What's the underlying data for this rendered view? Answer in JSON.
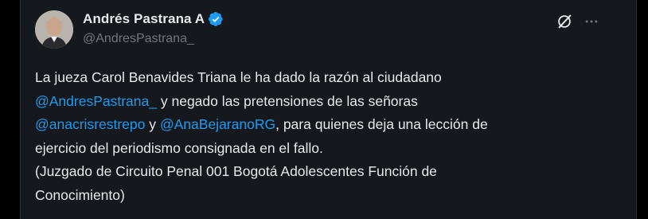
{
  "author": {
    "display_name": "Andrés Pastrana A",
    "handle": "@AndresPastrana_",
    "verified": true,
    "verified_color": "#1d9bf0"
  },
  "actions": {
    "grok_icon": "grok-icon",
    "more_icon": "more-icon"
  },
  "tweet": {
    "line1": "La jueza Carol Benavides Triana le ha dado la razón al ciudadano",
    "mention1": "@AndresPastrana_",
    "line2_rest": " y negado las pretensiones de las señoras",
    "mention2": "@anacrisrestrepo",
    "line3_mid": " y ",
    "mention3": "@AnaBejaranoRG",
    "line3_rest": ", para quienes deja una lección de",
    "line4": "ejercicio del periodismo consignada en el fallo.",
    "line5": "(Juzgado de Circuito Penal 001 Bogotá Adolescentes Función de",
    "line6": "Conocimiento)"
  },
  "colors": {
    "background": "#000000",
    "card": "#15181c",
    "text": "#e7e9ea",
    "muted": "#71767b",
    "link": "#1d9bf0"
  }
}
